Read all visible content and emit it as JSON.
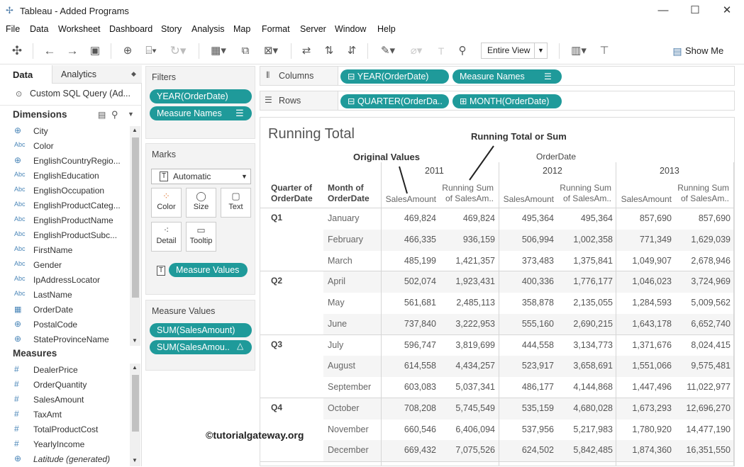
{
  "window": {
    "title": "Tableau - Added Programs",
    "minimize": "—",
    "maximize": "☐",
    "close": "✕"
  },
  "menu": [
    "File",
    "Data",
    "Worksheet",
    "Dashboard",
    "Story",
    "Analysis",
    "Map",
    "Format",
    "Server",
    "Window",
    "Help"
  ],
  "toolbar": {
    "fit": "Entire View",
    "show_me": "Show Me"
  },
  "leftpane": {
    "tab_data": "Data",
    "tab_analytics": "Analytics",
    "datasource": "Custom SQL Query (Ad...",
    "dimensions_title": "Dimensions",
    "dimensions": [
      {
        "icon": "globe",
        "label": "City"
      },
      {
        "icon": "Abc",
        "label": "Color"
      },
      {
        "icon": "globe",
        "label": "EnglishCountryRegio..."
      },
      {
        "icon": "Abc",
        "label": "EnglishEducation"
      },
      {
        "icon": "Abc",
        "label": "EnglishOccupation"
      },
      {
        "icon": "Abc",
        "label": "EnglishProductCateg..."
      },
      {
        "icon": "Abc",
        "label": "EnglishProductName"
      },
      {
        "icon": "Abc",
        "label": "EnglishProductSubc..."
      },
      {
        "icon": "Abc",
        "label": "FirstName"
      },
      {
        "icon": "Abc",
        "label": "Gender"
      },
      {
        "icon": "Abc",
        "label": "IpAddressLocator"
      },
      {
        "icon": "Abc",
        "label": "LastName"
      },
      {
        "icon": "calendar",
        "label": "OrderDate"
      },
      {
        "icon": "globe",
        "label": "PostalCode"
      },
      {
        "icon": "globe",
        "label": "StateProvinceName"
      }
    ],
    "measures_title": "Measures",
    "measures": [
      {
        "icon": "#",
        "label": "DealerPrice"
      },
      {
        "icon": "#",
        "label": "OrderQuantity"
      },
      {
        "icon": "#",
        "label": "SalesAmount"
      },
      {
        "icon": "#",
        "label": "TaxAmt"
      },
      {
        "icon": "#",
        "label": "TotalProductCost"
      },
      {
        "icon": "#",
        "label": "YearlyIncome"
      },
      {
        "icon": "globe",
        "label": "Latitude (generated)"
      }
    ]
  },
  "filters": {
    "title": "Filters",
    "pills": [
      "YEAR(OrderDate)",
      "Measure Names"
    ]
  },
  "marks": {
    "title": "Marks",
    "type": "Automatic",
    "buttons": [
      "Color",
      "Size",
      "Text",
      "Detail",
      "Tooltip"
    ],
    "pill": "Measure Values"
  },
  "measure_values": {
    "title": "Measure Values",
    "pills": [
      "SUM(SalesAmount)",
      "SUM(SalesAmou.."
    ]
  },
  "shelves": {
    "columns_label": "Columns",
    "columns": [
      "YEAR(OrderDate)",
      "Measure Names"
    ],
    "rows_label": "Rows",
    "rows": [
      "QUARTER(OrderDa..",
      "MONTH(OrderDate)"
    ]
  },
  "viz": {
    "title": "Running Total",
    "annotation_orig": "Original Values",
    "annotation_running": "Running Total or Sum",
    "orderdate_label": "OrderDate",
    "years": [
      "2011",
      "2012",
      "2013"
    ],
    "col_quarter": "Quarter of OrderDate",
    "col_month": "Month of OrderDate",
    "col_sales": "SalesAmount",
    "col_running": "Running Sum of SalesAm..",
    "watermark": "©tutorialgateway.org",
    "quarters": [
      {
        "q": "Q1",
        "months": [
          {
            "m": "January",
            "v": [
              "469,824",
              "469,824",
              "495,364",
              "495,364",
              "857,690",
              "857,690"
            ]
          },
          {
            "m": "February",
            "v": [
              "466,335",
              "936,159",
              "506,994",
              "1,002,358",
              "771,349",
              "1,629,039"
            ]
          },
          {
            "m": "March",
            "v": [
              "485,199",
              "1,421,357",
              "373,483",
              "1,375,841",
              "1,049,907",
              "2,678,946"
            ]
          }
        ]
      },
      {
        "q": "Q2",
        "months": [
          {
            "m": "April",
            "v": [
              "502,074",
              "1,923,431",
              "400,336",
              "1,776,177",
              "1,046,023",
              "3,724,969"
            ]
          },
          {
            "m": "May",
            "v": [
              "561,681",
              "2,485,113",
              "358,878",
              "2,135,055",
              "1,284,593",
              "5,009,562"
            ]
          },
          {
            "m": "June",
            "v": [
              "737,840",
              "3,222,953",
              "555,160",
              "2,690,215",
              "1,643,178",
              "6,652,740"
            ]
          }
        ]
      },
      {
        "q": "Q3",
        "months": [
          {
            "m": "July",
            "v": [
              "596,747",
              "3,819,699",
              "444,558",
              "3,134,773",
              "1,371,676",
              "8,024,415"
            ]
          },
          {
            "m": "August",
            "v": [
              "614,558",
              "4,434,257",
              "523,917",
              "3,658,691",
              "1,551,066",
              "9,575,481"
            ]
          },
          {
            "m": "September",
            "v": [
              "603,083",
              "5,037,341",
              "486,177",
              "4,144,868",
              "1,447,496",
              "11,022,977"
            ]
          }
        ]
      },
      {
        "q": "Q4",
        "months": [
          {
            "m": "October",
            "v": [
              "708,208",
              "5,745,549",
              "535,159",
              "4,680,028",
              "1,673,293",
              "12,696,270"
            ]
          },
          {
            "m": "November",
            "v": [
              "660,546",
              "6,406,094",
              "537,956",
              "5,217,983",
              "1,780,920",
              "14,477,190"
            ]
          },
          {
            "m": "December",
            "v": [
              "669,432",
              "7,075,526",
              "624,502",
              "5,842,485",
              "1,874,360",
              "16,351,550"
            ]
          }
        ]
      }
    ]
  }
}
